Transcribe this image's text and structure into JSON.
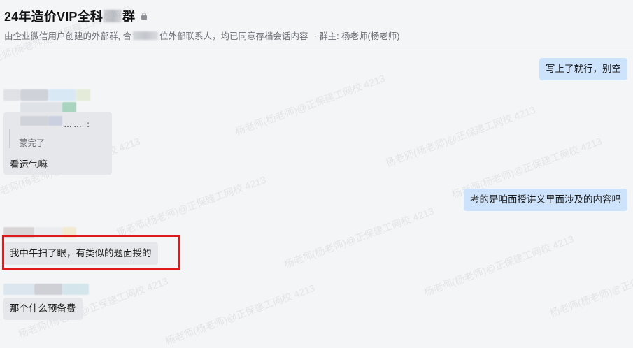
{
  "header": {
    "title_prefix": "24年造价VIP全科",
    "title_suffix": "群",
    "subtitle_prefix": "由企业微信用户创建的外部群, 合",
    "subtitle_middle": "位外部联系人，均已同意存档会话内容",
    "subtitle_owner": "· 群主: 杨老师(杨老师)"
  },
  "watermark": {
    "text": "杨老师(杨老师)@正保建工网校 4213"
  },
  "messages": [
    {
      "side": "right",
      "text": "写上了就行，别空"
    },
    {
      "side": "left",
      "quote_header": "…… :",
      "quote_text": "蒙完了",
      "text": "看运气嘛"
    },
    {
      "side": "right",
      "text": "考的是咱面授讲义里面涉及的内容吗"
    },
    {
      "side": "left",
      "text": "我中午扫了眼，有类似的题面授的",
      "highlighted": true
    },
    {
      "side": "left",
      "text": "那个什么预备费"
    }
  ],
  "colors": {
    "background": "#f4f5f7",
    "right_bubble": "#cde3fb",
    "left_bubble": "#e6e7ea",
    "highlight": "#e0191b"
  }
}
